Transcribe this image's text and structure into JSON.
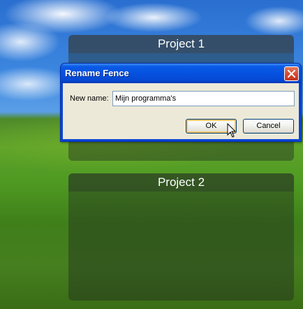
{
  "fences": [
    {
      "title": "Project 1"
    },
    {
      "title": "Project 2"
    }
  ],
  "dialog": {
    "title": "Rename Fence",
    "label": "New name:",
    "input_value": "Mijn programma's",
    "ok_label": "OK",
    "cancel_label": "Cancel",
    "close_icon": "close-icon"
  },
  "colors": {
    "title_bar": "#0651e0",
    "close_button": "#d6452a",
    "dialog_body": "#ece9d8"
  }
}
